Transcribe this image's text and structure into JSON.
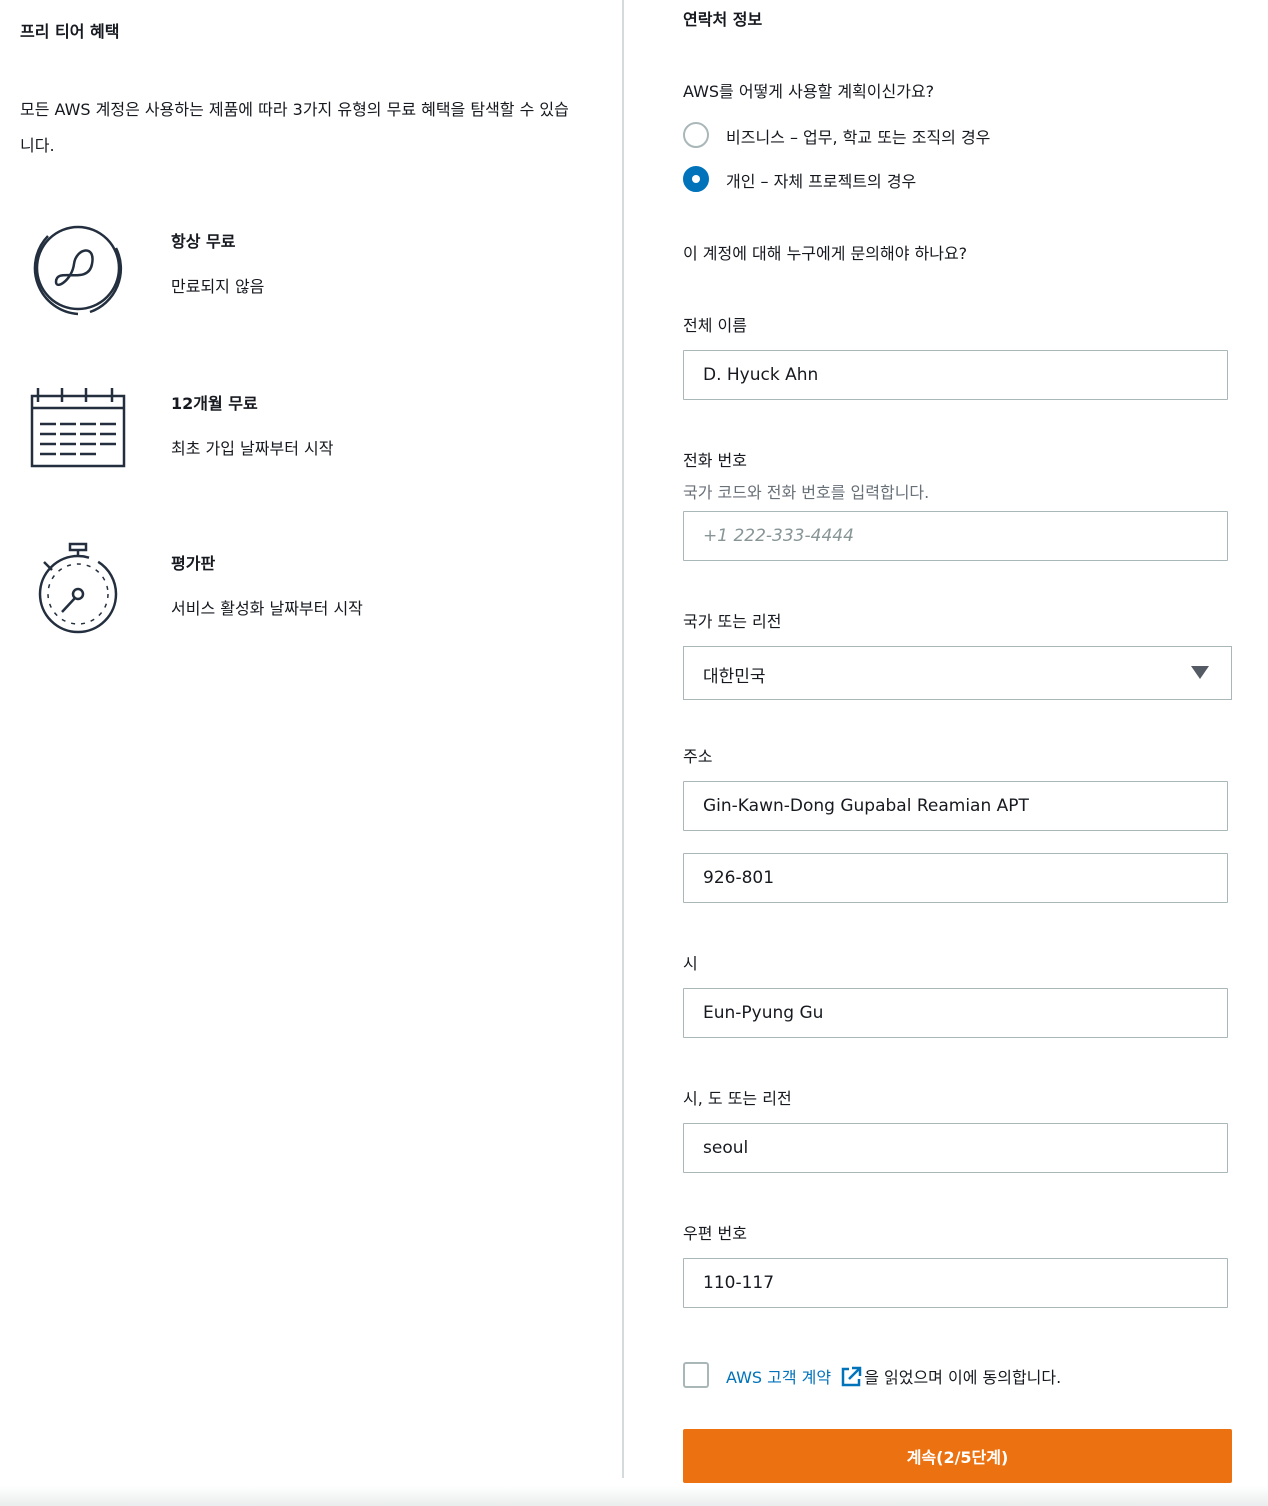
{
  "free_tier": {
    "title": "프리 티어 혜택",
    "description": "모든 AWS 계정은 사용하는 제품에 따라 3가지 유형의 무료 혜택을 탐색할 수 있습니다.",
    "benefits": [
      {
        "title": "항상 무료",
        "desc": "만료되지 않음",
        "icon": "infinity-icon"
      },
      {
        "title": "12개월 무료",
        "desc": "최초 가입 날짜부터 시작",
        "icon": "calendar-icon"
      },
      {
        "title": "평가판",
        "desc": "서비스 활성화 날짜부터 시작",
        "icon": "stopwatch-icon"
      }
    ]
  },
  "contact": {
    "title": "연락처 정보",
    "usage_question": "AWS를 어떻게 사용할 계획이신가요?",
    "usage_options": [
      {
        "label": "비즈니스 – 업무, 학교 또는 조직의 경우",
        "selected": false
      },
      {
        "label": "개인 – 자체 프로젝트의 경우",
        "selected": true
      }
    ],
    "contact_question": "이 계정에 대해 누구에게 문의해야 하나요?",
    "full_name": {
      "label": "전체 이름",
      "value": "D. Hyuck Ahn"
    },
    "phone": {
      "label": "전화 번호",
      "hint": "국가 코드와 전화 번호를 입력합니다.",
      "placeholder": "+1 222-333-4444",
      "value": ""
    },
    "country": {
      "label": "국가 또는 리전",
      "value": "대한민국"
    },
    "address": {
      "label": "주소",
      "line1": "Gin-Kawn-Dong Gupabal Reamian APT",
      "line2": "926-801"
    },
    "city": {
      "label": "시",
      "value": "Eun-Pyung Gu"
    },
    "state": {
      "label": "시, 도 또는 리전",
      "value": "seoul"
    },
    "postal": {
      "label": "우편 번호",
      "value": "110-117"
    },
    "agreement": {
      "link_text": "AWS 고객 계약",
      "text": "을 읽었으며 이에 동의합니다.",
      "checked": false
    },
    "continue_label": "계속(2/5단계)"
  },
  "colors": {
    "accent": "#0073bb",
    "button": "#ec7211",
    "border": "#aab7b8"
  }
}
